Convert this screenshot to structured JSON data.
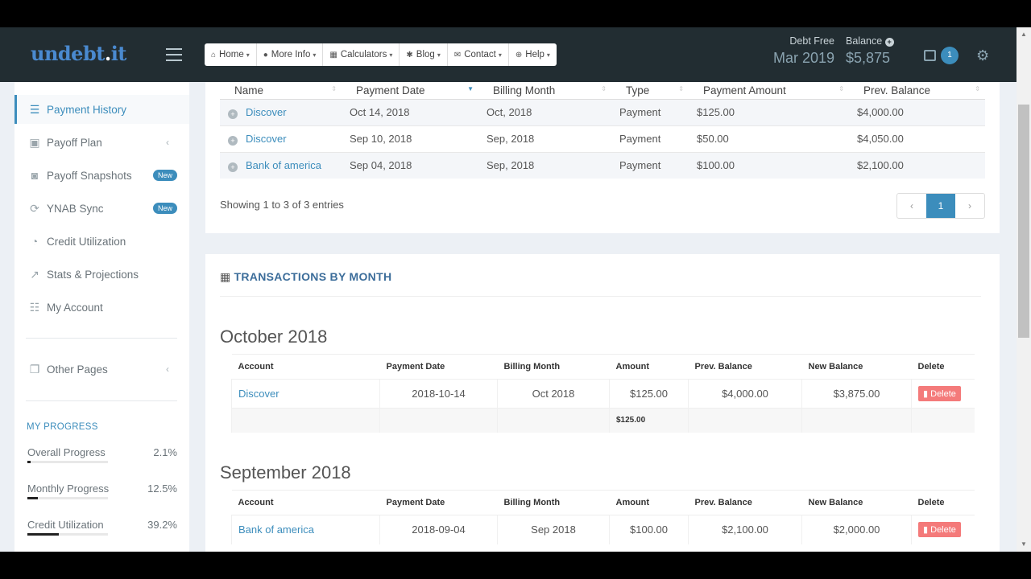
{
  "brand": {
    "logo_main": "undebt",
    "logo_dot": ".",
    "logo_tail": "it"
  },
  "nav": [
    {
      "icon": "⌂",
      "label": "Home"
    },
    {
      "icon": "●",
      "label": "More Info"
    },
    {
      "icon": "▦",
      "label": "Calculators"
    },
    {
      "icon": "✱",
      "label": "Blog"
    },
    {
      "icon": "✉",
      "label": "Contact"
    },
    {
      "icon": "⊕",
      "label": "Help"
    }
  ],
  "header": {
    "debt_free_label": "Debt Free",
    "debt_free_value": "Mar 2019",
    "balance_label": "Balance",
    "balance_value": "$5,875",
    "notifications_count": "1"
  },
  "sidebar": {
    "items": [
      {
        "label": "Payment History",
        "icon": "list-icon",
        "glyph": "☰",
        "active": true
      },
      {
        "label": "Payoff Plan",
        "icon": "calendar-check-icon",
        "glyph": "▣"
      },
      {
        "label": "Payoff Snapshots",
        "icon": "camera-icon",
        "glyph": "◙",
        "badge": "New"
      },
      {
        "label": "YNAB Sync",
        "icon": "refresh-icon",
        "glyph": "⟳",
        "badge": "New"
      },
      {
        "label": "Credit Utilization",
        "icon": "pie-chart-icon",
        "glyph": "◔"
      },
      {
        "label": "Stats & Projections",
        "icon": "line-chart-icon",
        "glyph": "↗"
      },
      {
        "label": "My Account",
        "icon": "sliders-icon",
        "glyph": "☷"
      },
      {
        "label": "Other Pages",
        "icon": "copy-icon",
        "glyph": "❐"
      }
    ],
    "progress_title": "MY PROGRESS",
    "progress": [
      {
        "label": "Overall Progress",
        "value": "2.1%",
        "fraction": 0.021
      },
      {
        "label": "Monthly Progress",
        "value": "12.5%",
        "fraction": 0.125
      },
      {
        "label": "Credit Utilization",
        "value": "39.2%",
        "fraction": 0.392
      }
    ]
  },
  "history_table": {
    "headers": [
      "Name",
      "Payment Date",
      "Billing Month",
      "Type",
      "Payment Amount",
      "Prev. Balance"
    ],
    "rows": [
      [
        "Discover",
        "Oct 14, 2018",
        "Oct, 2018",
        "Payment",
        "$125.00",
        "$4,000.00"
      ],
      [
        "Discover",
        "Sep 10, 2018",
        "Sep, 2018",
        "Payment",
        "$50.00",
        "$4,050.00"
      ],
      [
        "Bank of america",
        "Sep 04, 2018",
        "Sep, 2018",
        "Payment",
        "$100.00",
        "$2,100.00"
      ]
    ],
    "showing": "Showing 1 to 3 of 3 entries",
    "pager": {
      "prev": "‹",
      "current": "1",
      "next": "›"
    }
  },
  "by_month": {
    "title": "TRANSACTIONS BY MONTH",
    "headers": [
      "Account",
      "Payment Date",
      "Billing Month",
      "Amount",
      "Prev. Balance",
      "New Balance",
      "Delete"
    ],
    "delete_label": "Delete",
    "months": [
      {
        "name": "October 2018",
        "rows": [
          [
            "Discover",
            "2018-10-14",
            "Oct 2018",
            "$125.00",
            "$4,000.00",
            "$3,875.00"
          ]
        ],
        "total": "$125.00"
      },
      {
        "name": "September 2018",
        "rows": [
          [
            "Bank of america",
            "2018-09-04",
            "Sep 2018",
            "$100.00",
            "$2,100.00",
            "$2,000.00"
          ]
        ]
      }
    ]
  },
  "colors": {
    "header_bg": "#222d32",
    "accent": "#3c8dbc",
    "danger": "#f47a7a"
  }
}
